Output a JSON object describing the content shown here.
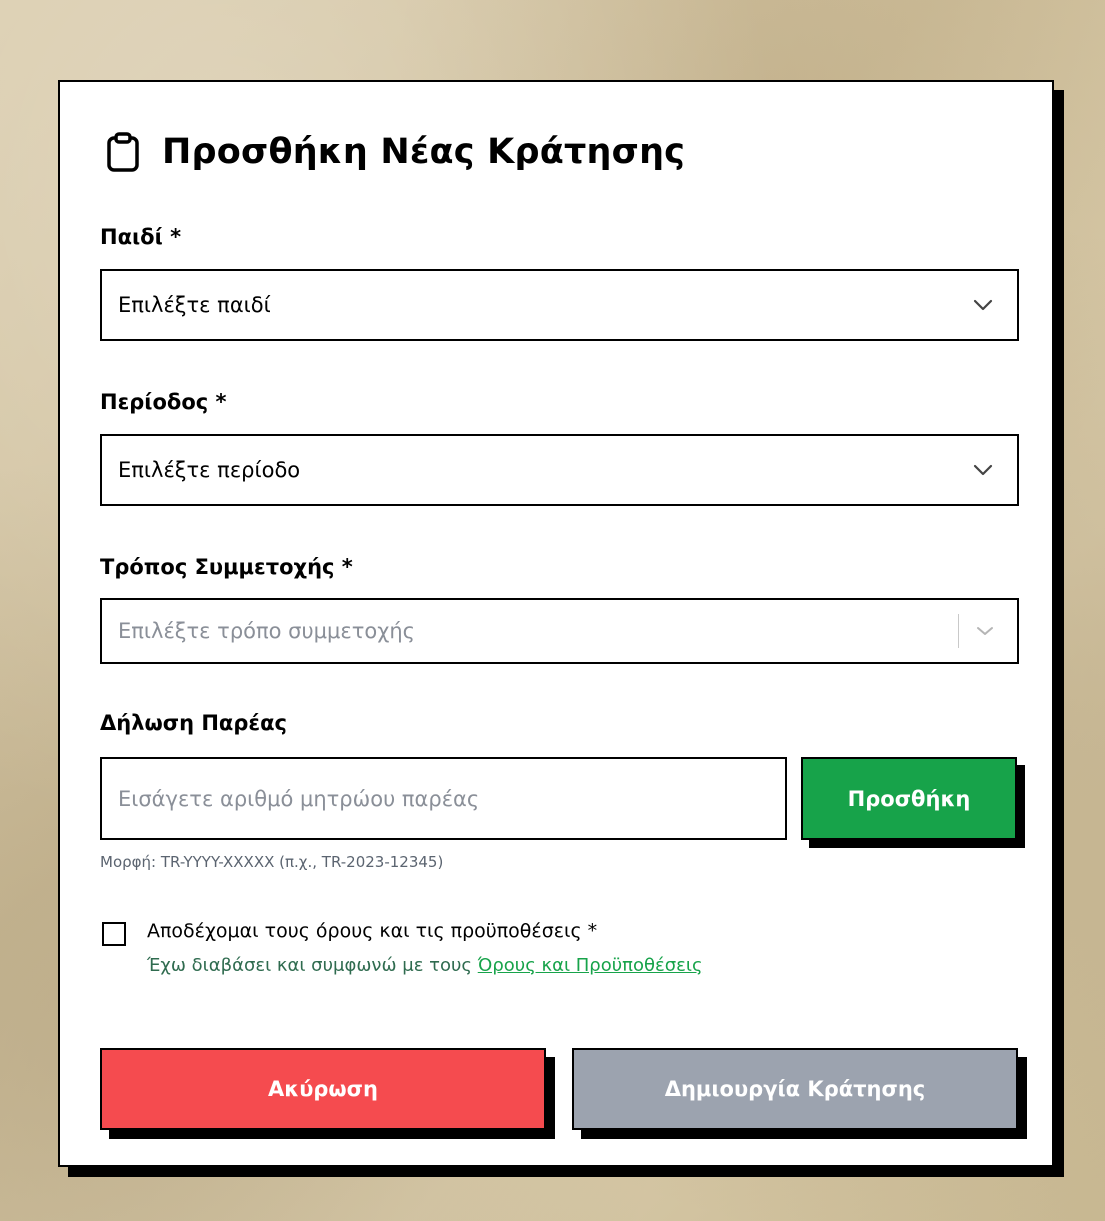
{
  "modal": {
    "title": "Προσθήκη Νέας Κράτησης",
    "title_icon": "clipboard-icon"
  },
  "fields": {
    "child": {
      "label": "Παιδί *",
      "selected_value": "Επιλέξτε παιδί"
    },
    "period": {
      "label": "Περίοδος *",
      "selected_value": "Επιλέξτε περίοδο"
    },
    "participation": {
      "label": "Τρόπος Συμμετοχής *",
      "placeholder": "Επιλέξτε τρόπο συμμετοχής"
    },
    "group": {
      "label": "Δήλωση Παρέας",
      "placeholder": "Εισάγετε αριθμό μητρώου παρέας",
      "value": "",
      "add_button": "Προσθήκη",
      "hint": "Μορφή: TR-YYYY-XXXXX (π.χ., TR-2023-12345)"
    }
  },
  "terms": {
    "checked": false,
    "label": "Αποδέχομαι τους όρους και τις προϋποθέσεις *",
    "sub_text": "Έχω διαβάσει και συμφωνώ με τους ",
    "link_text": "Όρους και Προϋποθέσεις"
  },
  "actions": {
    "cancel": "Ακύρωση",
    "create": "Δημιουργία Κράτησης"
  },
  "colors": {
    "accent_green": "#17a34a",
    "cancel_red": "#f54b4f",
    "disabled_gray": "#9ca3af",
    "border": "#000000"
  }
}
